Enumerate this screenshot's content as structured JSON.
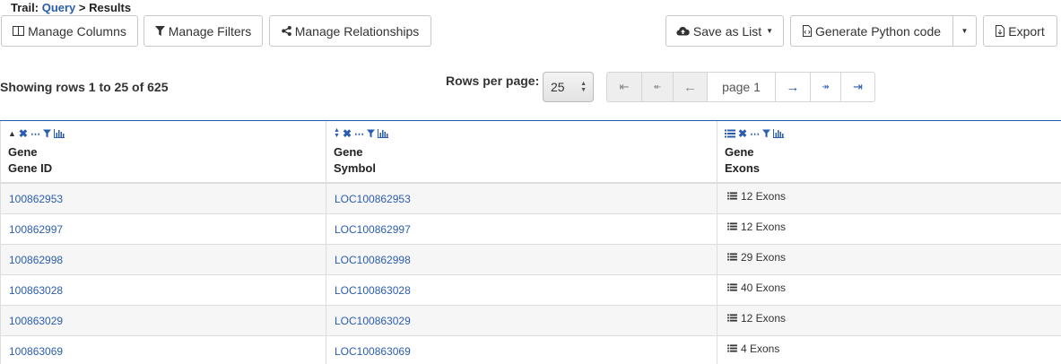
{
  "trail": {
    "prefix": "Trail:",
    "link": "Query",
    "separator": ">",
    "current": "Results"
  },
  "toolbar": {
    "manage_columns": "Manage Columns",
    "manage_filters": "Manage Filters",
    "manage_relationships": "Manage Relationships",
    "save_as_list": "Save as List",
    "generate_python": "Generate Python code",
    "export": "Export"
  },
  "summary": {
    "showing": "Showing rows 1 to 25 of 625"
  },
  "paging": {
    "rows_per_page_label": "Rows per page:",
    "rows_per_page_value": "25",
    "page_label": "page 1",
    "first": "⇤",
    "back_many": "↞",
    "prev": "←",
    "next": "→",
    "fwd_many": "↠",
    "last": "⇥"
  },
  "table": {
    "columns": [
      {
        "line1": "Gene",
        "line2": "Gene ID",
        "sort": "ascending"
      },
      {
        "line1": "Gene",
        "line2": "Symbol",
        "sort": "unsorted"
      },
      {
        "line1": "Gene",
        "line2": "Exons",
        "sort": "collection"
      }
    ],
    "rows": [
      {
        "id": "100862953",
        "symbol": "LOC100862953",
        "exons": "12 Exons"
      },
      {
        "id": "100862997",
        "symbol": "LOC100862997",
        "exons": "12 Exons"
      },
      {
        "id": "100862998",
        "symbol": "LOC100862998",
        "exons": "29 Exons"
      },
      {
        "id": "100863028",
        "symbol": "LOC100863028",
        "exons": "40 Exons"
      },
      {
        "id": "100863029",
        "symbol": "LOC100863029",
        "exons": "12 Exons"
      },
      {
        "id": "100863069",
        "symbol": "LOC100863069",
        "exons": "4 Exons"
      }
    ]
  },
  "colors": {
    "link": "#2a5db0",
    "border": "#dddddd",
    "row_alt": "#f6f6f6"
  }
}
